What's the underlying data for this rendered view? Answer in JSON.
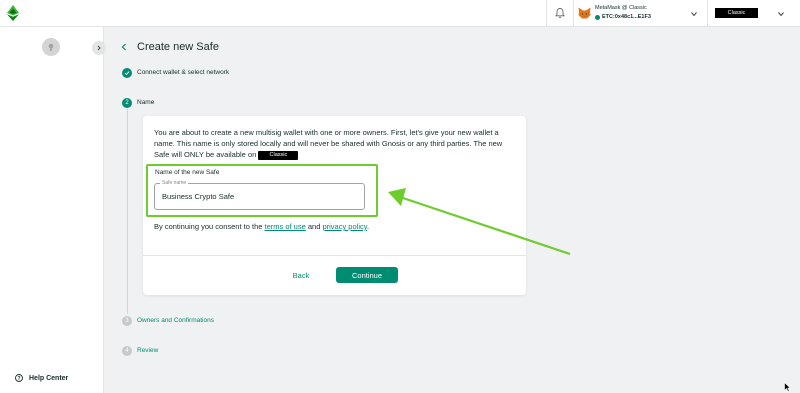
{
  "header": {
    "logo": "ethereum-classic-logo",
    "wallet": {
      "name": "MetaMask @ Classic",
      "address": "ETC:0x48c1...E1F3",
      "provider_icon": "metamask-fox-icon"
    },
    "network": "Classic"
  },
  "sidebar": {
    "help_label": "Help Center"
  },
  "page": {
    "title": "Create new Safe"
  },
  "steps": [
    {
      "number": "1",
      "label": "Connect wallet & select network",
      "state": "done"
    },
    {
      "number": "2",
      "label": "Name",
      "state": "active"
    },
    {
      "number": "3",
      "label": "Owners and Confirmations",
      "state": "pending"
    },
    {
      "number": "4",
      "label": "Review",
      "state": "pending"
    }
  ],
  "card": {
    "description": "You are about to create a new multisig wallet with one or more owners. First, let's give your new wallet a name. This name is only stored locally and will never be shared with Gnosis or any third parties. The new Safe will ONLY be available on",
    "network_pill": "Classic",
    "field_title": "Name of the new Safe",
    "field_legend": "Safe name",
    "field_value": "Business Crypto Safe",
    "consent_prefix": "By continuing you consent to the",
    "terms_link": "terms of use",
    "consent_and": "and",
    "privacy_link": "privacy policy",
    "consent_suffix": ".",
    "back_label": "Back",
    "continue_label": "Continue"
  },
  "colors": {
    "primary": "#008c73",
    "highlight": "#6ecc2c",
    "background": "#f0f1f2"
  }
}
